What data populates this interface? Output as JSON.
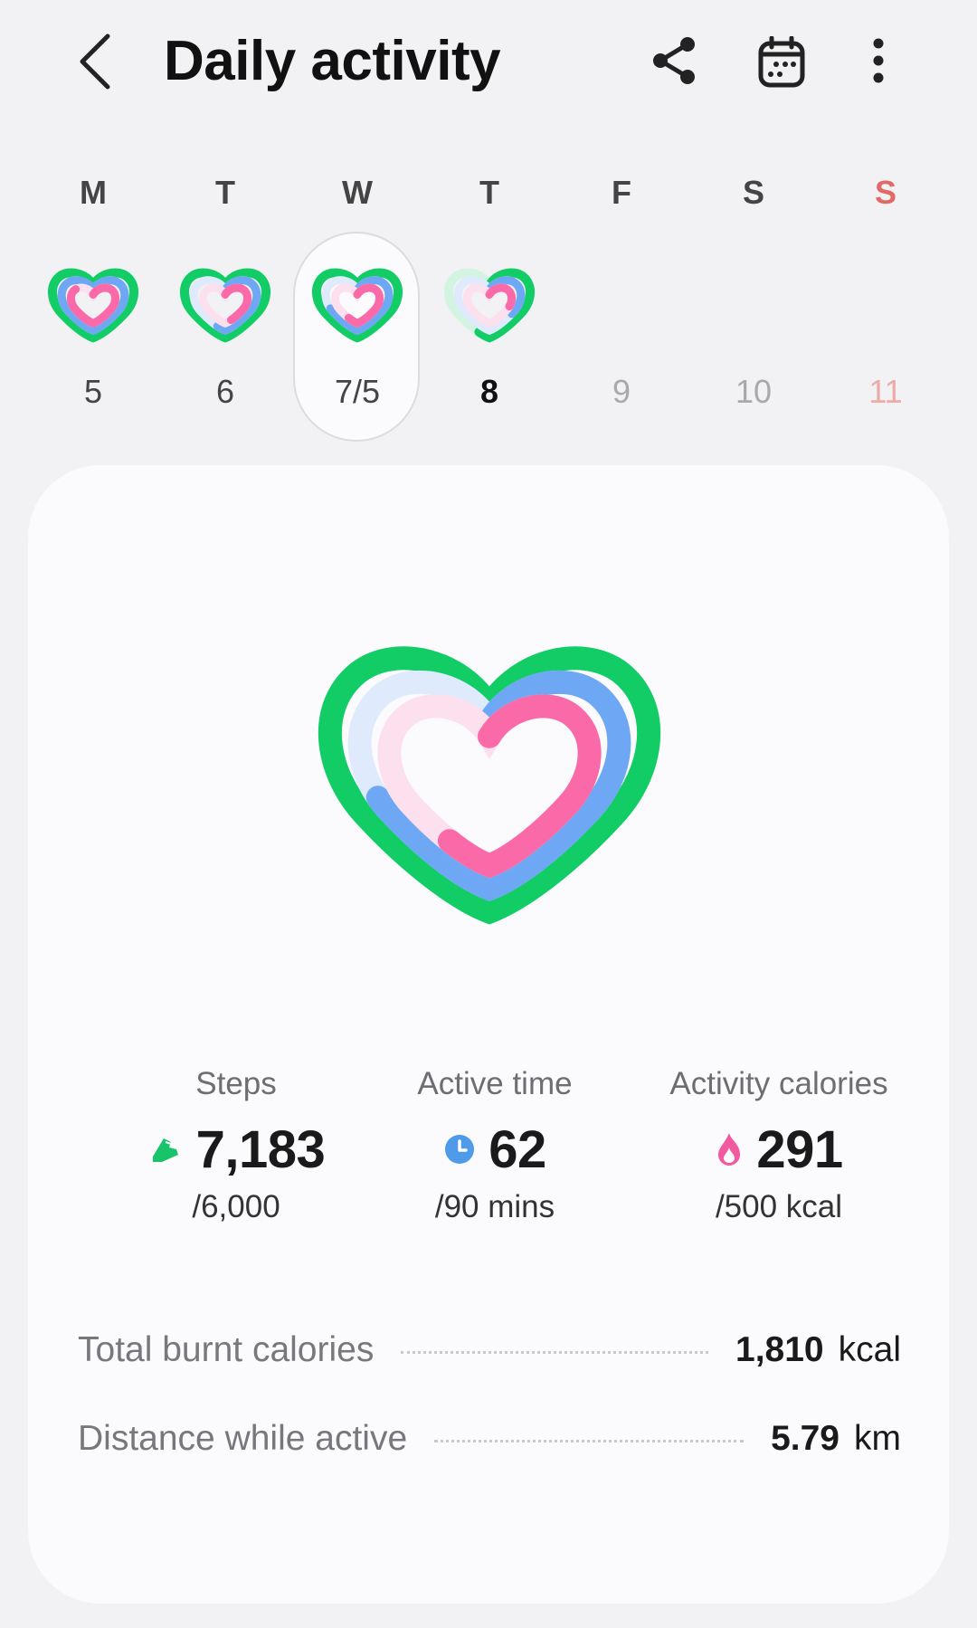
{
  "header": {
    "title": "Daily activity",
    "back_icon": "chevron-left-icon",
    "share_icon": "share-icon",
    "calendar_icon": "calendar-icon",
    "more_icon": "more-vertical-icon"
  },
  "week": {
    "days": [
      {
        "letter": "M",
        "number": "5",
        "has_ring": true,
        "rings": {
          "steps": 1.0,
          "active": 1.0,
          "calories": 0.85
        }
      },
      {
        "letter": "T",
        "number": "6",
        "has_ring": true,
        "rings": {
          "steps": 1.0,
          "active": 0.55,
          "calories": 0.45
        }
      },
      {
        "letter": "W",
        "number": "7/5",
        "has_ring": true,
        "selected": true,
        "rings": {
          "steps": 1.0,
          "active": 0.69,
          "calories": 0.58
        }
      },
      {
        "letter": "T",
        "number": "8",
        "has_ring": true,
        "bold": true,
        "rings": {
          "steps": 0.55,
          "active": 0.35,
          "calories": 0.3
        }
      },
      {
        "letter": "F",
        "number": "9",
        "has_ring": false
      },
      {
        "letter": "S",
        "number": "10",
        "has_ring": false
      },
      {
        "letter": "S",
        "number": "11",
        "has_ring": false,
        "sunday": true
      }
    ]
  },
  "stats": {
    "steps": {
      "label": "Steps",
      "value": "7,183",
      "goal": "/6,000",
      "icon": "shoe-icon",
      "color": "#19c36a"
    },
    "active_time": {
      "label": "Active time",
      "value": "62",
      "goal": "/90 mins",
      "icon": "clock-icon",
      "color": "#4f9be9"
    },
    "activity_calories": {
      "label": "Activity calories",
      "value": "291",
      "goal": "/500 kcal",
      "icon": "flame-icon",
      "color": "#f25aa0"
    }
  },
  "summary": {
    "total_burnt": {
      "label": "Total burnt calories",
      "value": "1,810",
      "unit": "kcal"
    },
    "distance": {
      "label": "Distance while active",
      "value": "5.79",
      "unit": "km"
    }
  },
  "colors": {
    "steps_ring": "#12cc66",
    "active_ring": "#6ea8f5",
    "calories_ring": "#fb6aa8",
    "background": "#f2f2f4",
    "card": "#fbfbfd"
  }
}
